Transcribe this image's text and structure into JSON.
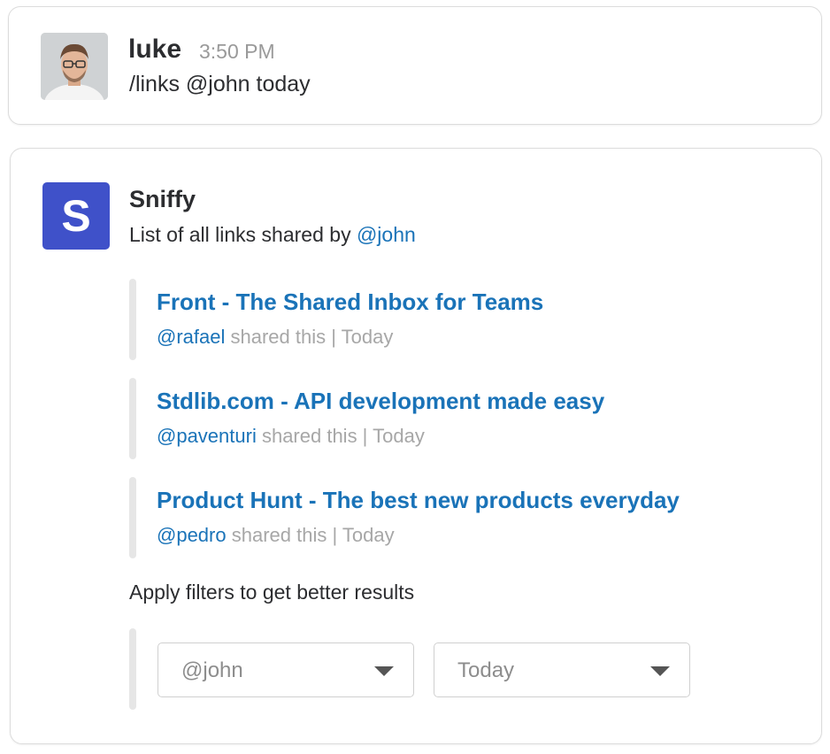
{
  "user_message": {
    "author": "luke",
    "time": "3:50 PM",
    "text": "/links @john today"
  },
  "bot_message": {
    "name": "Sniffy",
    "avatar_letter": "S",
    "avatar_color": "#3f51c9",
    "intro_prefix": "List of all links shared by ",
    "intro_mention": "@john",
    "links": [
      {
        "title": "Front - The Shared Inbox for Teams",
        "user": "@rafael",
        "shared": " shared this | Today"
      },
      {
        "title": "Stdlib.com - API development made easy",
        "user": "@paventuri",
        "shared": " shared this | Today"
      },
      {
        "title": "Product Hunt - The best new products everyday",
        "user": "@pedro",
        "shared": " shared this | Today"
      }
    ],
    "filter_hint": "Apply filters to get better results",
    "filters": {
      "user_value": "@john",
      "date_value": "Today"
    }
  },
  "colors": {
    "link": "#1a73b8",
    "meta": "#a7a7a7",
    "accent_bar": "#e6e6e6"
  }
}
